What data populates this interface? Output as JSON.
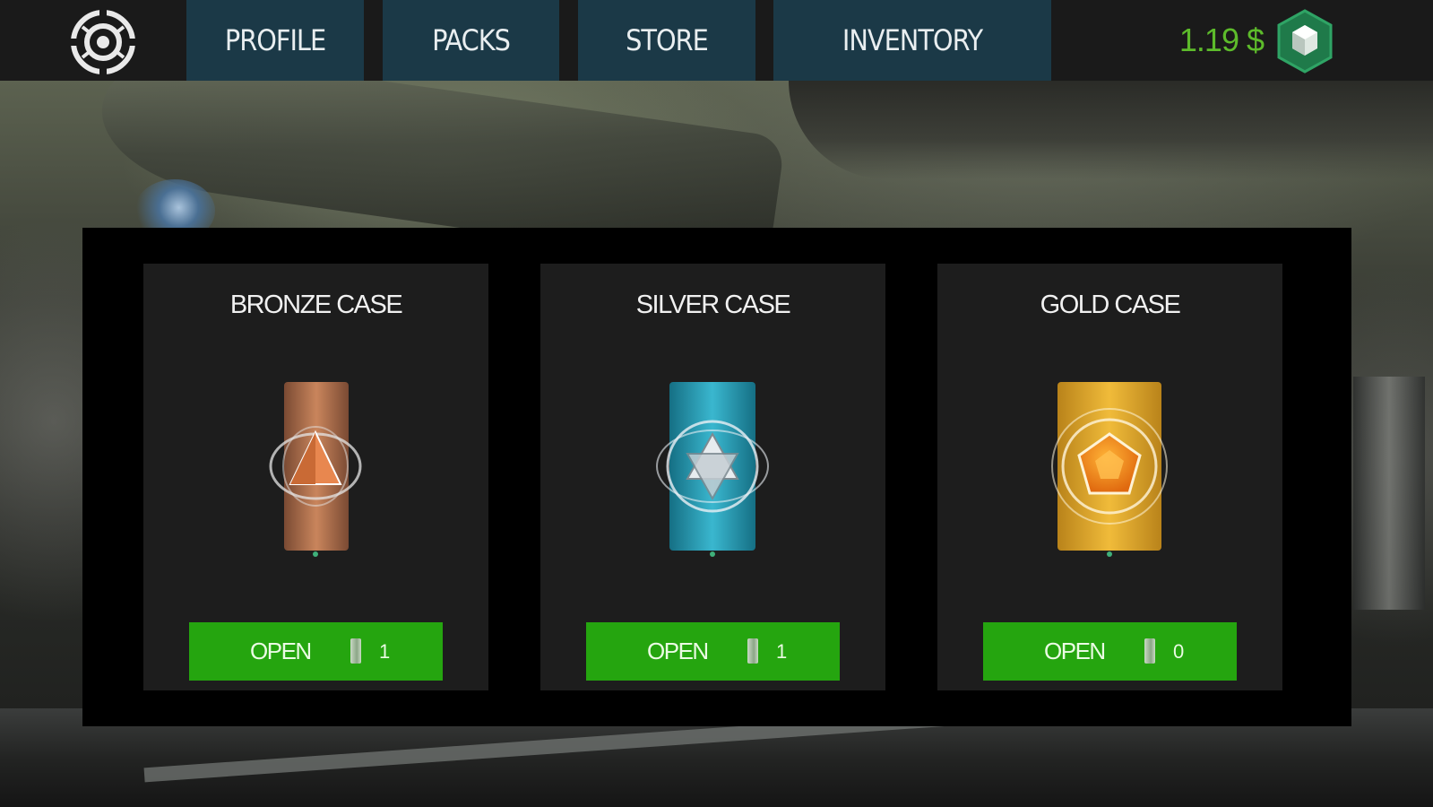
{
  "nav": {
    "tabs": [
      {
        "label": "PROFILE"
      },
      {
        "label": "PACKS"
      },
      {
        "label": "STORE"
      },
      {
        "label": "INVENTORY"
      }
    ]
  },
  "wallet": {
    "balance": "1.19 $",
    "currency_icon": "gem-icon",
    "accent_color": "#5dbb2b"
  },
  "cases": [
    {
      "title": "BRONZE CASE",
      "button_label": "OPEN",
      "key_count": "1",
      "theme": "bronze",
      "color": "#b8714c"
    },
    {
      "title": "SILVER CASE",
      "button_label": "OPEN",
      "key_count": "1",
      "theme": "silver",
      "color": "#2a9ab3"
    },
    {
      "title": "GOLD CASE",
      "button_label": "OPEN",
      "key_count": "0",
      "theme": "gold",
      "color": "#e0a520"
    }
  ],
  "colors": {
    "tab_background": "#1b3947",
    "open_button": "#25a50f",
    "card_background": "#1d1d1d"
  }
}
